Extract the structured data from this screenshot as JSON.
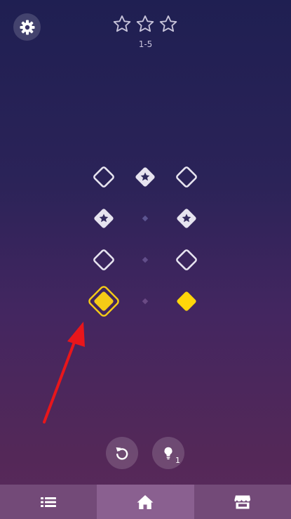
{
  "header": {
    "settings_icon": "gear-icon",
    "stars_total": 3,
    "stars_earned": 0,
    "level_label": "1-5"
  },
  "board": {
    "rows": [
      [
        "outline",
        "star",
        "outline"
      ],
      [
        "star",
        "dot",
        "star"
      ],
      [
        "outline",
        "dot",
        "outline"
      ],
      [
        "selected",
        "dot",
        "filled"
      ]
    ],
    "selected_color": "#f5cb16",
    "filled_color": "#ffd60a",
    "outline_color": "#e6e3ef"
  },
  "annotation": {
    "arrow_color": "#e8161b"
  },
  "controls": {
    "undo_icon": "undo-icon",
    "hint_icon": "lightbulb-icon",
    "hint_count": "1"
  },
  "navbar": {
    "tabs": [
      {
        "icon": "list-icon",
        "active": false
      },
      {
        "icon": "home-icon",
        "active": true
      },
      {
        "icon": "shop-icon",
        "active": false
      }
    ],
    "background": "#734a78"
  }
}
